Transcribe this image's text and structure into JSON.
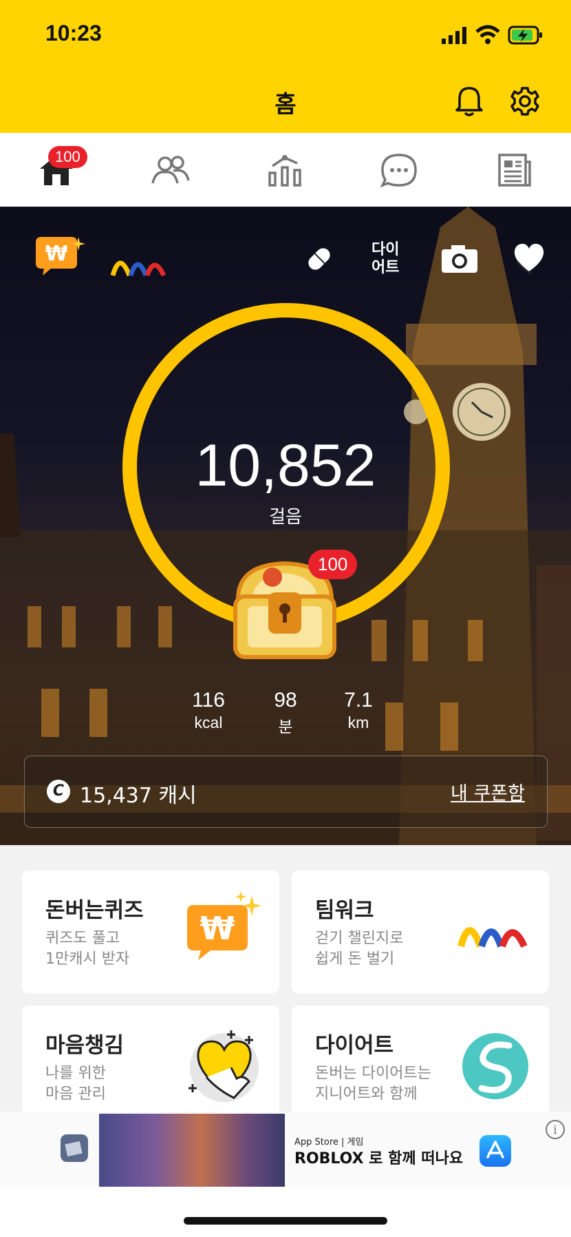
{
  "status_bar": {
    "time": "10:23"
  },
  "header": {
    "title": "홈"
  },
  "tabs": [
    {
      "name": "home",
      "badge": "100"
    },
    {
      "name": "friends"
    },
    {
      "name": "stats"
    },
    {
      "name": "chat"
    },
    {
      "name": "news"
    }
  ],
  "hero": {
    "steps": "10,852",
    "steps_label": "걸음",
    "chest_badge": "100",
    "diet_label_line1": "다이",
    "diet_label_line2": "어트",
    "stats": [
      {
        "value": "116",
        "unit": "kcal"
      },
      {
        "value": "98",
        "unit": "분"
      },
      {
        "value": "7.1",
        "unit": "km"
      }
    ],
    "cash_icon": "C",
    "cash": "15,437 캐시",
    "coupon_link": "내 쿠폰함",
    "goal_ring_progress": 1.0
  },
  "cards": [
    {
      "title": "돈버는퀴즈",
      "line1": "퀴즈도 풀고",
      "line2": "1만캐시 받자",
      "icon": "quiz-won-icon"
    },
    {
      "title": "팀워크",
      "line1": "걷기 챌린지로",
      "line2": "쉽게 돈 벌기",
      "icon": "teamwork-logo-icon"
    },
    {
      "title": "마음챙김",
      "line1": "나를 위한",
      "line2": "마음 관리",
      "icon": "heart-hand-icon"
    },
    {
      "title": "다이어트",
      "line1": "돈버는 다이어트는",
      "line2": "지니어트와 함께",
      "icon": "dietgenie-logo-icon"
    }
  ],
  "ad": {
    "small_text": "App Store | 게임",
    "main_text": "ROBLOX 로 함께 떠나요",
    "info": "i"
  },
  "colors": {
    "brand_yellow": "#ffd400",
    "ring": "#ffc400",
    "badge_red": "#e8212b"
  }
}
